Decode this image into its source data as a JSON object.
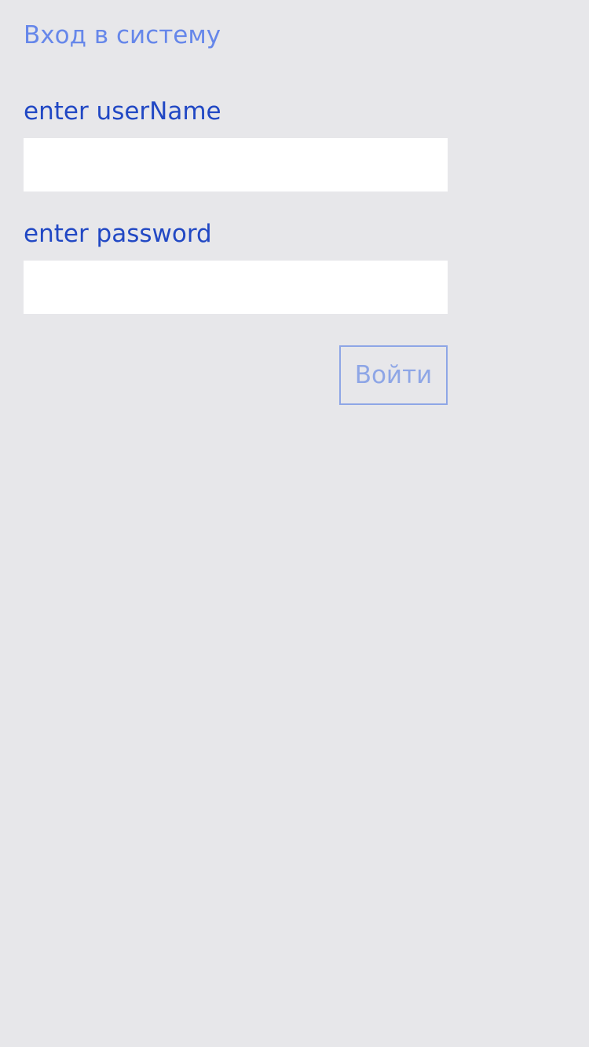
{
  "login": {
    "title": "Вход в систему",
    "username_label": "enter userName",
    "username_value": "",
    "password_label": "enter password",
    "password_value": "",
    "submit_label": "Войти"
  },
  "colors": {
    "background": "#e7e7ea",
    "title": "#6687ea",
    "label": "#2148c4",
    "button": "#8ea6e6",
    "input_bg": "#ffffff"
  }
}
